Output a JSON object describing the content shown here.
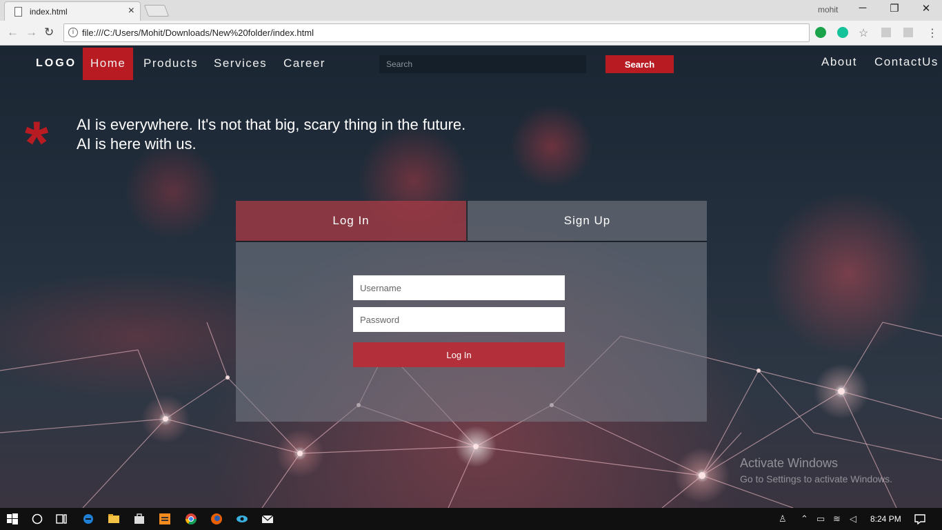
{
  "browser": {
    "tab_title": "index.html",
    "tab_close": "×",
    "user": "mohit",
    "url": "file:///C:/Users/Mohit/Downloads/New%20folder/index.html",
    "minimize": "─",
    "restore": "❐",
    "close": "✕",
    "back": "←",
    "forward": "→",
    "reload": "↻",
    "info": "i",
    "star": "☆",
    "menu": "⋮"
  },
  "nav": {
    "logo": "LOGO",
    "items": [
      "Home",
      "Products",
      "Services",
      "Career"
    ],
    "search_placeholder": "Search",
    "search_button": "Search",
    "right_links": [
      "About",
      "ContactUs"
    ]
  },
  "hero": {
    "asterisk": "*",
    "quote": "AI is everywhere. It's not that big, scary thing in the future. AI is here with us."
  },
  "auth": {
    "tab_login": "Log In",
    "tab_signup": "Sign Up",
    "username_placeholder": "Username",
    "password_placeholder": "Password",
    "submit": "Log In"
  },
  "watermark": {
    "line1": "Activate Windows",
    "line2": "Go to Settings to activate Windows."
  },
  "taskbar": {
    "time": "8:24 PM"
  },
  "colors": {
    "accent": "#b81c22",
    "login_tab": "#a03a44",
    "signup_tab": "#5f646e"
  }
}
